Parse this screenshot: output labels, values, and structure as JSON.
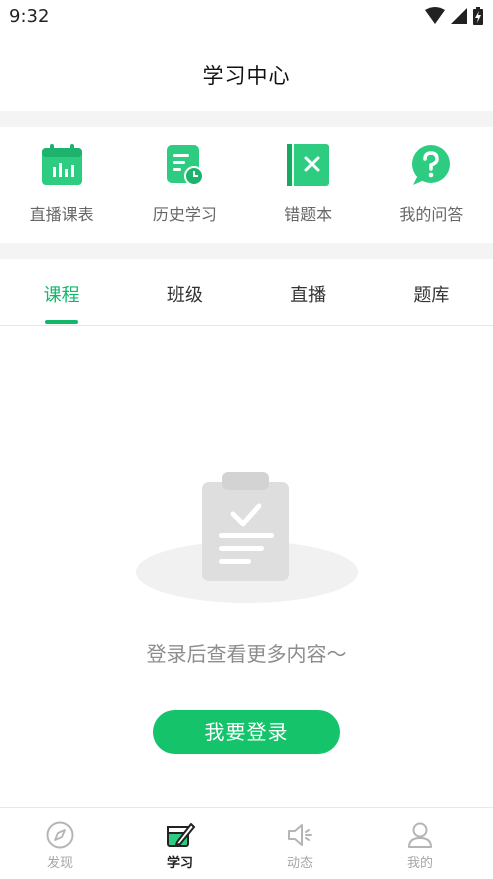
{
  "status": {
    "time": "9:32"
  },
  "header": {
    "title": "学习中心"
  },
  "shortcuts": [
    {
      "label": "直播课表",
      "icon": "calendar-chart-icon"
    },
    {
      "label": "历史学习",
      "icon": "history-doc-icon"
    },
    {
      "label": "错题本",
      "icon": "wrong-book-icon"
    },
    {
      "label": "我的问答",
      "icon": "question-bubble-icon"
    }
  ],
  "tabs": [
    {
      "label": "课程",
      "active": true
    },
    {
      "label": "班级",
      "active": false
    },
    {
      "label": "直播",
      "active": false
    },
    {
      "label": "题库",
      "active": false
    }
  ],
  "empty": {
    "message": "登录后查看更多内容～",
    "icon": "clipboard-check-icon"
  },
  "login_button": {
    "label": "我要登录"
  },
  "bottom_nav": [
    {
      "label": "发现",
      "icon": "compass-icon",
      "active": false
    },
    {
      "label": "学习",
      "icon": "study-icon",
      "active": true
    },
    {
      "label": "动态",
      "icon": "speaker-icon",
      "active": false
    },
    {
      "label": "我的",
      "icon": "user-icon",
      "active": false
    }
  ],
  "colors": {
    "accent": "#12b76a",
    "button": "#14c36a"
  }
}
